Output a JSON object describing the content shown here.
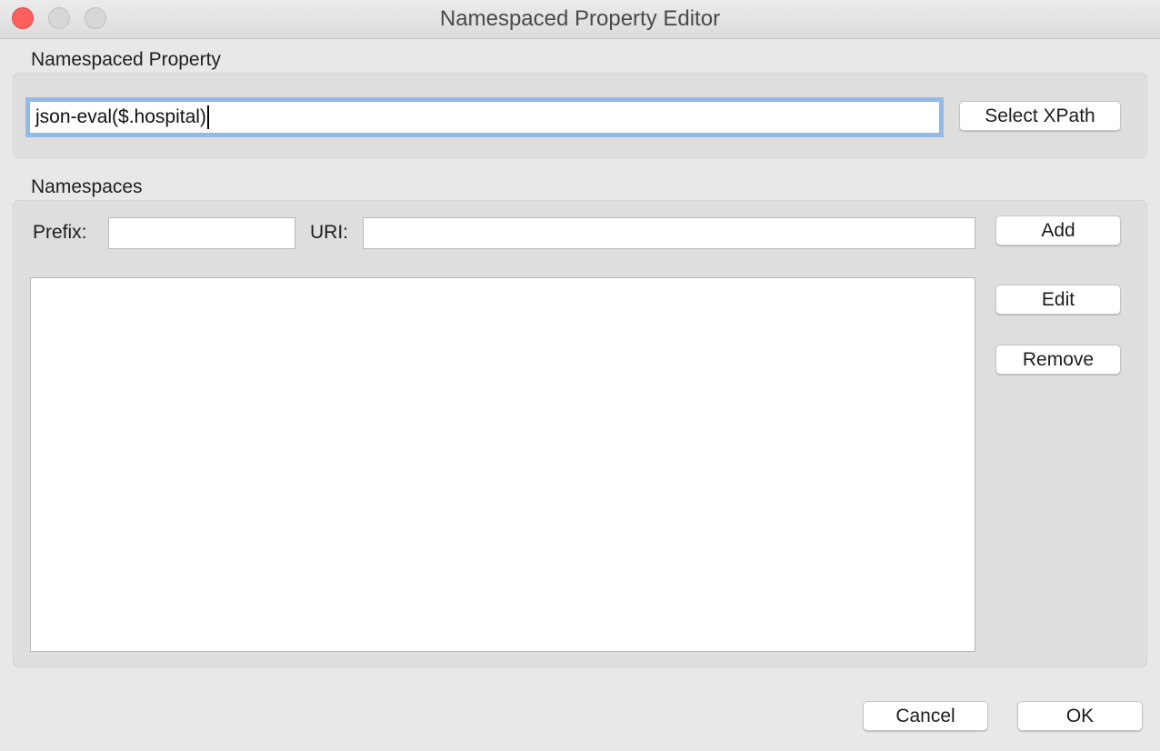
{
  "window": {
    "title": "Namespaced Property Editor"
  },
  "property_section": {
    "label": "Namespaced Property",
    "expression_value": "json-eval($.hospital)",
    "select_xpath_label": "Select XPath"
  },
  "namespaces_section": {
    "label": "Namespaces",
    "prefix_label": "Prefix:",
    "prefix_value": "",
    "uri_label": "URI:",
    "uri_value": "",
    "add_label": "Add",
    "edit_label": "Edit",
    "remove_label": "Remove",
    "items": []
  },
  "footer": {
    "cancel_label": "Cancel",
    "ok_label": "OK"
  },
  "colors": {
    "close_button": "#fc605c",
    "focus_ring": "#92bbe8"
  },
  "icons": {
    "close": "close-icon",
    "minimize": "minimize-icon",
    "maximize": "maximize-icon"
  }
}
